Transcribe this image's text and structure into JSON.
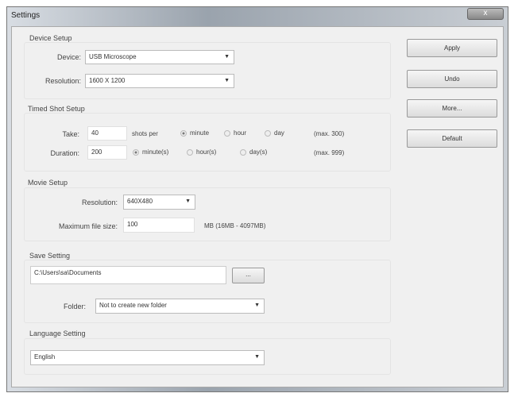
{
  "window": {
    "title": "Settings",
    "close_label": "x"
  },
  "device_setup": {
    "label": "Device Setup",
    "device_label": "Device:",
    "device_value": "USB Microscope",
    "resolution_label": "Resolution:",
    "resolution_value": "1600 X 1200"
  },
  "timed_shot": {
    "label": "Timed Shot Setup",
    "take_label": "Take:",
    "take_value": "40",
    "shots_per": "shots per",
    "take_units": [
      "minute",
      "hour",
      "day"
    ],
    "take_selected": "minute",
    "take_max": "(max. 300)",
    "duration_label": "Duration:",
    "duration_value": "200",
    "duration_units": [
      "minute(s)",
      "hour(s)",
      "day(s)"
    ],
    "duration_selected": "minute(s)",
    "duration_max": "(max. 999)"
  },
  "movie_setup": {
    "label": "Movie Setup",
    "resolution_label": "Resolution:",
    "resolution_value": "640X480",
    "max_size_label": "Maximum file size:",
    "max_size_value": "100",
    "max_size_hint": "MB (16MB - 4097MB)"
  },
  "save_setting": {
    "label": "Save Setting",
    "path_value": "C:\\Users\\sa\\Documents",
    "browse_label": "...",
    "folder_label": "Folder:",
    "folder_value": "Not to create new folder"
  },
  "language": {
    "label": "Language Setting",
    "value": "English"
  },
  "buttons": {
    "apply": "Apply",
    "undo": "Undo",
    "more": "More...",
    "default": "Default"
  },
  "arrow": "▼"
}
